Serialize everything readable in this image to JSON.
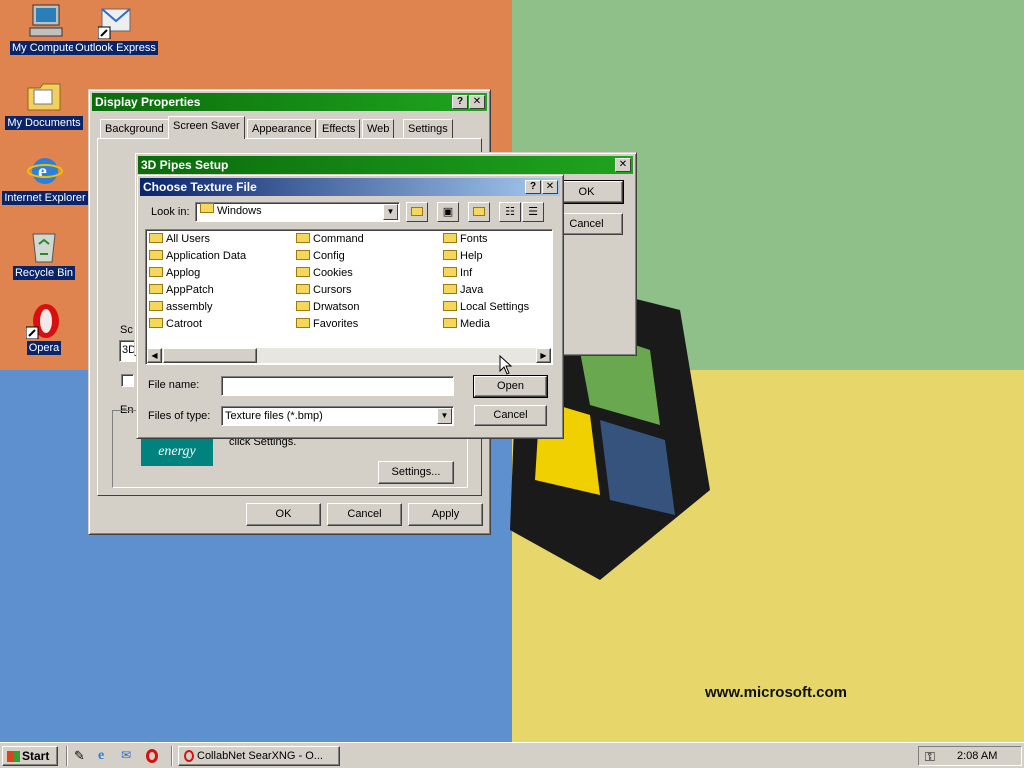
{
  "desktop": {
    "icons": [
      {
        "label": "My Computer",
        "icon": "computer-icon"
      },
      {
        "label": "Outlook Express",
        "icon": "outlook-icon"
      },
      {
        "label": "My Documents",
        "icon": "documents-folder-icon"
      },
      {
        "label": "Internet Explorer",
        "icon": "ie-icon"
      },
      {
        "label": "Recycle Bin",
        "icon": "recycle-bin-icon"
      },
      {
        "label": "Opera",
        "icon": "opera-icon"
      }
    ],
    "watermark": "www.microsoft.com"
  },
  "display_properties": {
    "title": "Display Properties",
    "tabs": [
      "Background",
      "Screen Saver",
      "Appearance",
      "Effects",
      "Web",
      "Settings"
    ],
    "active_tab": "Screen Saver",
    "screensaver_value": "3D",
    "group_sc": "Sc",
    "group_en": "En",
    "energy_text": "click Settings.",
    "settings_button": "Settings...",
    "ok": "OK",
    "cancel": "Cancel",
    "apply": "Apply"
  },
  "pipes_setup": {
    "title": "3D Pipes Setup",
    "ok": "OK",
    "cancel": "Cancel"
  },
  "choose_texture": {
    "title": "Choose Texture File",
    "look_in_label": "Look in:",
    "look_in_value": "Windows",
    "files": [
      [
        "All Users",
        "Application Data",
        "Applog",
        "AppPatch",
        "assembly",
        "Catroot"
      ],
      [
        "Command",
        "Config",
        "Cookies",
        "Cursors",
        "Drwatson",
        "Favorites"
      ],
      [
        "Fonts",
        "Help",
        "Inf",
        "Java",
        "Local Settings",
        "Media"
      ]
    ],
    "file_name_label": "File name:",
    "file_name_value": "",
    "files_of_type_label": "Files of type:",
    "files_of_type_value": "Texture files (*.bmp)",
    "open": "Open",
    "cancel": "Cancel"
  },
  "taskbar": {
    "start": "Start",
    "task": "CollabNet SearXNG - O...",
    "clock": "2:08 AM"
  }
}
